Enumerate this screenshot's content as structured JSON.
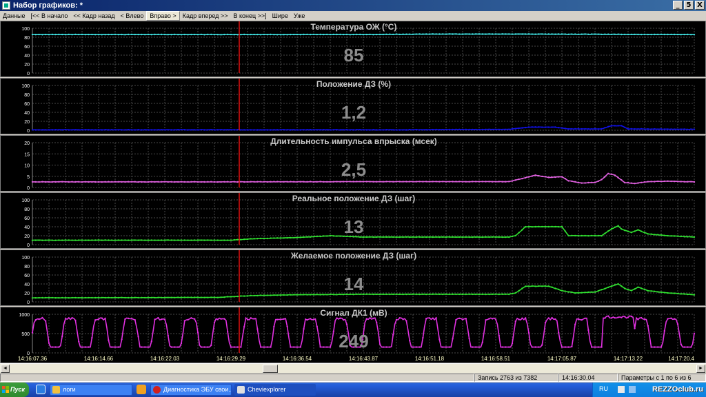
{
  "window": {
    "title": "Набор графиков: *",
    "buttons": [
      "_",
      "5",
      "X"
    ]
  },
  "menu": [
    {
      "label": "Данные",
      "active": false
    },
    {
      "label": "[<< В начало",
      "active": false
    },
    {
      "label": "<< Кадр назад",
      "active": false
    },
    {
      "label": "< Влево",
      "active": false
    },
    {
      "label": "Вправо >",
      "active": true
    },
    {
      "label": "Кадр вперед >>",
      "active": false
    },
    {
      "label": "В конец >>]",
      "active": false
    },
    {
      "label": "Шире",
      "active": false
    },
    {
      "label": "Уже",
      "active": false
    }
  ],
  "colors": {
    "grid": "#4a4a4a",
    "cursor": "#e01010",
    "label": "#c8c8c8",
    "big_value": "#8c8c8c",
    "tick_label": "#ffffff",
    "time_label": "#ffffc8"
  },
  "chart_data": [
    {
      "type": "line",
      "title": "Температура ОЖ  (°С)",
      "current_value": "85",
      "color": "#40e0e0",
      "ylim": [
        0,
        100
      ],
      "yticks": [
        "100",
        "80",
        "60",
        "40",
        "20",
        "0"
      ],
      "points": [
        [
          0,
          86
        ],
        [
          0.2,
          86
        ],
        [
          0.4,
          86
        ],
        [
          0.5,
          86
        ],
        [
          0.6,
          87
        ],
        [
          0.75,
          87
        ],
        [
          1,
          86
        ]
      ]
    },
    {
      "type": "line",
      "title": "Положение ДЗ  (%)",
      "current_value": "1,2",
      "color": "#1010e0",
      "ylim": [
        0,
        100
      ],
      "yticks": [
        "100",
        "80",
        "60",
        "40",
        "20",
        "0"
      ],
      "points": [
        [
          0,
          1
        ],
        [
          0.33,
          1
        ],
        [
          0.55,
          1
        ],
        [
          0.72,
          2
        ],
        [
          0.75,
          7
        ],
        [
          0.79,
          7
        ],
        [
          0.81,
          3
        ],
        [
          0.86,
          3
        ],
        [
          0.875,
          10
        ],
        [
          0.89,
          10
        ],
        [
          0.9,
          3
        ],
        [
          1,
          2
        ]
      ]
    },
    {
      "type": "line",
      "title": "Длительность импульса впрыска  (мсек)",
      "current_value": "2,5",
      "color": "#e060e0",
      "ylim": [
        0,
        20
      ],
      "yticks": [
        "20",
        "15",
        "10",
        "5",
        "0"
      ],
      "points": [
        [
          0,
          2.5
        ],
        [
          0.3,
          2.5
        ],
        [
          0.5,
          2.6
        ],
        [
          0.72,
          2.6
        ],
        [
          0.74,
          4
        ],
        [
          0.76,
          5.5
        ],
        [
          0.78,
          4.5
        ],
        [
          0.8,
          4.8
        ],
        [
          0.81,
          3
        ],
        [
          0.83,
          2
        ],
        [
          0.85,
          2.2
        ],
        [
          0.86,
          3.5
        ],
        [
          0.87,
          6.2
        ],
        [
          0.88,
          5.5
        ],
        [
          0.895,
          2.2
        ],
        [
          0.91,
          1.8
        ],
        [
          0.93,
          2.6
        ],
        [
          0.96,
          2.8
        ],
        [
          1,
          2.5
        ]
      ]
    },
    {
      "type": "line",
      "title": "Реальное положение ДЗ  (шаг)",
      "current_value": "13",
      "color": "#30e030",
      "ylim": [
        0,
        100
      ],
      "yticks": [
        "100",
        "80",
        "60",
        "40",
        "20",
        "0"
      ],
      "points": [
        [
          0,
          10
        ],
        [
          0.3,
          10
        ],
        [
          0.33,
          13
        ],
        [
          0.4,
          16
        ],
        [
          0.45,
          20
        ],
        [
          0.5,
          17
        ],
        [
          0.72,
          17
        ],
        [
          0.73,
          20
        ],
        [
          0.745,
          40
        ],
        [
          0.8,
          40
        ],
        [
          0.81,
          20
        ],
        [
          0.86,
          20
        ],
        [
          0.875,
          35
        ],
        [
          0.885,
          42
        ],
        [
          0.89,
          35
        ],
        [
          0.905,
          27
        ],
        [
          0.915,
          33
        ],
        [
          0.93,
          24
        ],
        [
          0.96,
          20
        ],
        [
          1,
          17
        ]
      ]
    },
    {
      "type": "line",
      "title": "Желаемое положение ДЗ  (шаг)",
      "current_value": "14",
      "color": "#30e030",
      "ylim": [
        0,
        100
      ],
      "yticks": [
        "100",
        "80",
        "60",
        "40",
        "20",
        "0"
      ],
      "points": [
        [
          0,
          9
        ],
        [
          0.28,
          10
        ],
        [
          0.33,
          14
        ],
        [
          0.4,
          16
        ],
        [
          0.5,
          17
        ],
        [
          0.72,
          17
        ],
        [
          0.73,
          20
        ],
        [
          0.745,
          35
        ],
        [
          0.78,
          35
        ],
        [
          0.8,
          25
        ],
        [
          0.82,
          20
        ],
        [
          0.85,
          22
        ],
        [
          0.875,
          35
        ],
        [
          0.885,
          40
        ],
        [
          0.895,
          30
        ],
        [
          0.905,
          25
        ],
        [
          0.915,
          33
        ],
        [
          0.93,
          25
        ],
        [
          0.96,
          20
        ],
        [
          1,
          16
        ]
      ]
    },
    {
      "type": "line",
      "title": "Сигнал ДК1  (мВ)",
      "current_value": "249",
      "color": "#e030e0",
      "ylim": [
        0,
        1000
      ],
      "yticks": [
        "1000",
        "500",
        "0"
      ],
      "oscillating": true,
      "points": [],
      "xticks": [
        "14:16:07.36",
        "14:16:14.66",
        "14:16:22.03",
        "14:16:29.29",
        "14:16:36.54",
        "14:16:43.87",
        "14:16:51.18",
        "14:16:58.51",
        "14:17:05.87",
        "14:17:13.22",
        "14:17:20.4"
      ]
    }
  ],
  "scrollbar": {
    "left_arrow": "◄",
    "right_arrow": "►"
  },
  "status": {
    "record": "Запись 2763 из 7382",
    "time": "14:16:30.04",
    "params": "Параметры с 1 по 6 из 6"
  },
  "taskbar": {
    "start": "Пуск",
    "items": [
      {
        "label": "логи",
        "active": false
      },
      {
        "label": "Диагностика ЭБУ свои...",
        "active": false
      },
      {
        "label": "Cheviexplorer",
        "active": true
      }
    ],
    "lang": "RU",
    "logo": "REZZOclub.ru"
  }
}
